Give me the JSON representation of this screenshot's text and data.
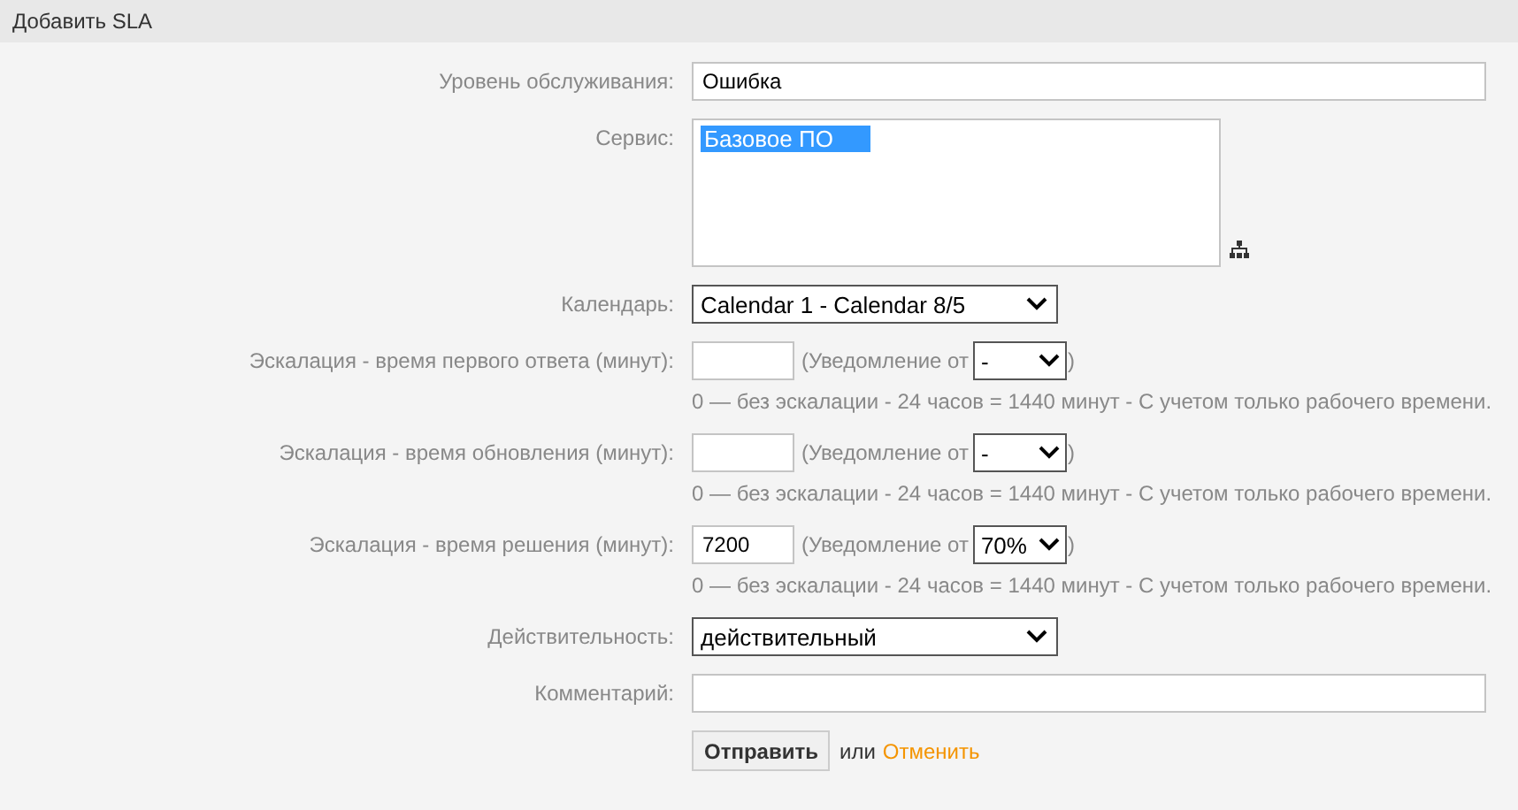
{
  "header": {
    "title": "Добавить SLA"
  },
  "fields": [
    {
      "kind": "text",
      "label": "Уровень обслуживания:",
      "value": "Ошибка"
    },
    {
      "kind": "listbox",
      "label": "Сервис:",
      "options": [
        {
          "text": "Базовое ПО",
          "selected": true
        }
      ]
    },
    {
      "kind": "select",
      "label": "Календарь:",
      "value": "Calendar 1 - Calendar 8/5"
    },
    {
      "kind": "escalation",
      "label": "Эскалация - время первого ответа (минут):",
      "notify_open": "(Уведомление от",
      "notify_value": "-",
      "notify_close": ")",
      "hint": "0 — без эскалации - 24 часов = 1440 минут - С учетом только рабочего времени."
    },
    {
      "kind": "escalation",
      "label": "Эскалация - время обновления (минут):",
      "notify_open": "(Уведомление от",
      "notify_value": "-",
      "notify_close": ")",
      "hint": "0 — без эскалации - 24 часов = 1440 минут - С учетом только рабочего времени."
    },
    {
      "kind": "escalation",
      "label": "Эскалация - время решения (минут):",
      "value": "7200",
      "notify_open": "(Уведомление от",
      "notify_value": "70%",
      "notify_close": ")",
      "hint": "0 — без эскалации - 24 часов = 1440 минут - С учетом только рабочего времени."
    },
    {
      "kind": "select",
      "label": "Действительность:",
      "value": "действительный"
    },
    {
      "kind": "text",
      "label": "Комментарий:"
    }
  ],
  "actions": {
    "submit": "Отправить",
    "or": "или",
    "cancel": "Отменить"
  }
}
